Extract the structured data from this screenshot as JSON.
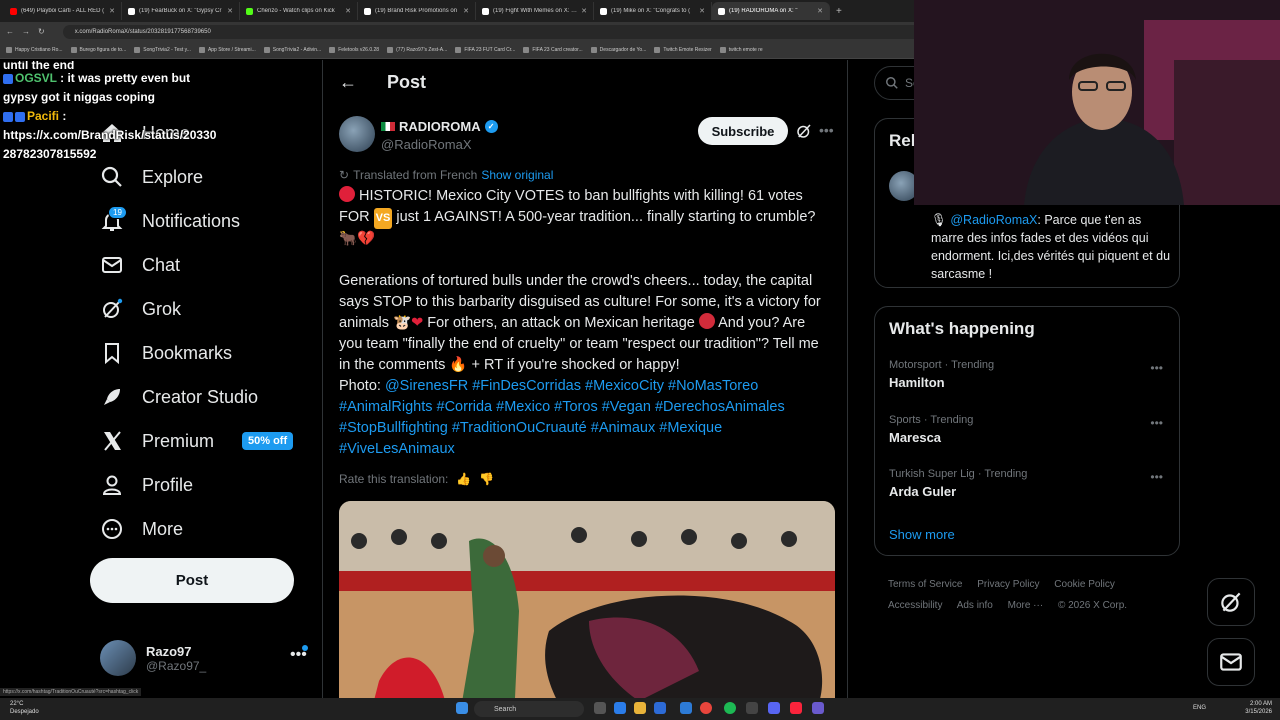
{
  "browser": {
    "tabs": [
      {
        "label": "(649) Playboi Carti - ALL RED (",
        "color": "#ff0000",
        "active": false
      },
      {
        "label": "(19) FearBuck on X: \"Gypsy Cr",
        "color": "#ffffff",
        "active": false
      },
      {
        "label": "Chenzo - Watch clips on Kick",
        "color": "#53fc18",
        "active": false
      },
      {
        "label": "(19) Brand Risk Promotions on",
        "color": "#ffffff",
        "active": false
      },
      {
        "label": "(19) Fight With Memes on X: \"C",
        "color": "#ffffff",
        "active": false
      },
      {
        "label": "(19) Mike on X: \"Congrats to (",
        "color": "#ffffff",
        "active": false
      },
      {
        "label": "(19) RADIOROMA on X: \"",
        "color": "#ffffff",
        "active": true
      }
    ],
    "url": "x.com/RadioRomaX/status/2032819177568739650",
    "bookmarks": [
      "Happy Cristiano Ro...",
      "Burego figura de to...",
      "SongTrivia2 - Test y...",
      "App Store / Streami...",
      "SongTrivia2 - Adivin...",
      "Feletools v26.0.28",
      "(77) Razo97's Zest-A...",
      "FIFA 23 FUT Card Cr...",
      "FIFA 23 Card creator...",
      "Descargador de Yo...",
      "Twitch Emote Resizer",
      "twitch emote re"
    ]
  },
  "chat": {
    "top_line": "until the end",
    "msg1_user": "OGSVL",
    "msg1_text": ": it was pretty even but gypsy got it niggas coping",
    "msg2_user": "Pacifi",
    "msg2_text": ":",
    "msg2_link": "https://x.com/BrandRisk/status/2033028782307815592"
  },
  "sidebar": {
    "items": [
      {
        "label": "Home",
        "icon": "home-icon"
      },
      {
        "label": "Explore",
        "icon": "search-icon"
      },
      {
        "label": "Notifications",
        "icon": "bell-icon"
      },
      {
        "label": "Chat",
        "icon": "mail-icon"
      },
      {
        "label": "Grok",
        "icon": "grok-icon"
      },
      {
        "label": "Bookmarks",
        "icon": "bookmark-icon"
      },
      {
        "label": "Creator Studio",
        "icon": "rocket-icon"
      },
      {
        "label": "Premium",
        "icon": "x-logo-icon"
      },
      {
        "label": "Profile",
        "icon": "person-icon"
      },
      {
        "label": "More",
        "icon": "more-circle-icon"
      }
    ],
    "notifications_badge": "19",
    "premium_promo": "50% off",
    "post_button": "Post",
    "account_name": "Razo97",
    "account_handle": "@Razo97_",
    "status_url": "https://x.com/hashtag/TraditionOuCruauté?src=hashtag_click"
  },
  "main": {
    "header_title": "Post",
    "author_name": "RADIOROMA",
    "author_handle": "@RadioRomaX",
    "subscribe": "Subscribe",
    "translated_from": "Translated from French",
    "show_original": "Show original",
    "para1_a": "HISTORIC! Mexico City VOTES to ban bullfights with killing! 61 votes FOR",
    "vs": "VS",
    "para1_b": "just 1 AGAINST! A 500-year tradition... finally starting to crumble?",
    "para2_a": "Generations of tortured bulls under the crowd's cheers... today, the capital says STOP to this barbarity disguised as culture! For some, it's a victory for animals",
    "para2_b": "For others, an attack on Mexican heritage",
    "para2_c": "And you? Are you team \"finally the end of cruelty\" or team \"respect our tradition\"? Tell me in the comments",
    "para2_d": "+ RT if you're shocked or happy!",
    "photo_label": "Photo:",
    "hashtags": "@SirenesFR #FinDesCorridas #MexicoCity #NoMasToreo #AnimalRights #Corrida #Mexico #Toros #Vegan #DerechosAnimales #StopBullfighting #TraditionOuCruauté #Animaux #Mexique #ViveLesAnimaux",
    "rate_translation": "Rate this translation:"
  },
  "right": {
    "search_placeholder": "Se",
    "relevant_title": "Rel",
    "bio_mention": "@RadioRomaX",
    "bio_text": ": Parce que t'en as marre des infos fades et des vidéos qui endorment. Ici,des vérités qui piquent et du sarcasme !",
    "happening_title": "What's happening",
    "trends": [
      {
        "meta": "Motorsport · Trending",
        "name": "Hamilton"
      },
      {
        "meta": "Sports · Trending",
        "name": "Maresca"
      },
      {
        "meta": "Turkish Super Lig · Trending",
        "name": "Arda Guler"
      }
    ],
    "show_more": "Show more",
    "footer": [
      "Terms of Service",
      "Privacy Policy",
      "Cookie Policy",
      "Accessibility",
      "Ads info",
      "More ···",
      "© 2026 X Corp."
    ]
  },
  "taskbar": {
    "temp": "22°C",
    "weather": "Despejado",
    "search": "Search",
    "lang": "ENG",
    "time": "2:00 AM",
    "date": "3/15/2026"
  },
  "colors": {
    "accent": "#1d9bf0",
    "background": "#000000",
    "border": "#2f3336",
    "muted": "#71767b"
  }
}
